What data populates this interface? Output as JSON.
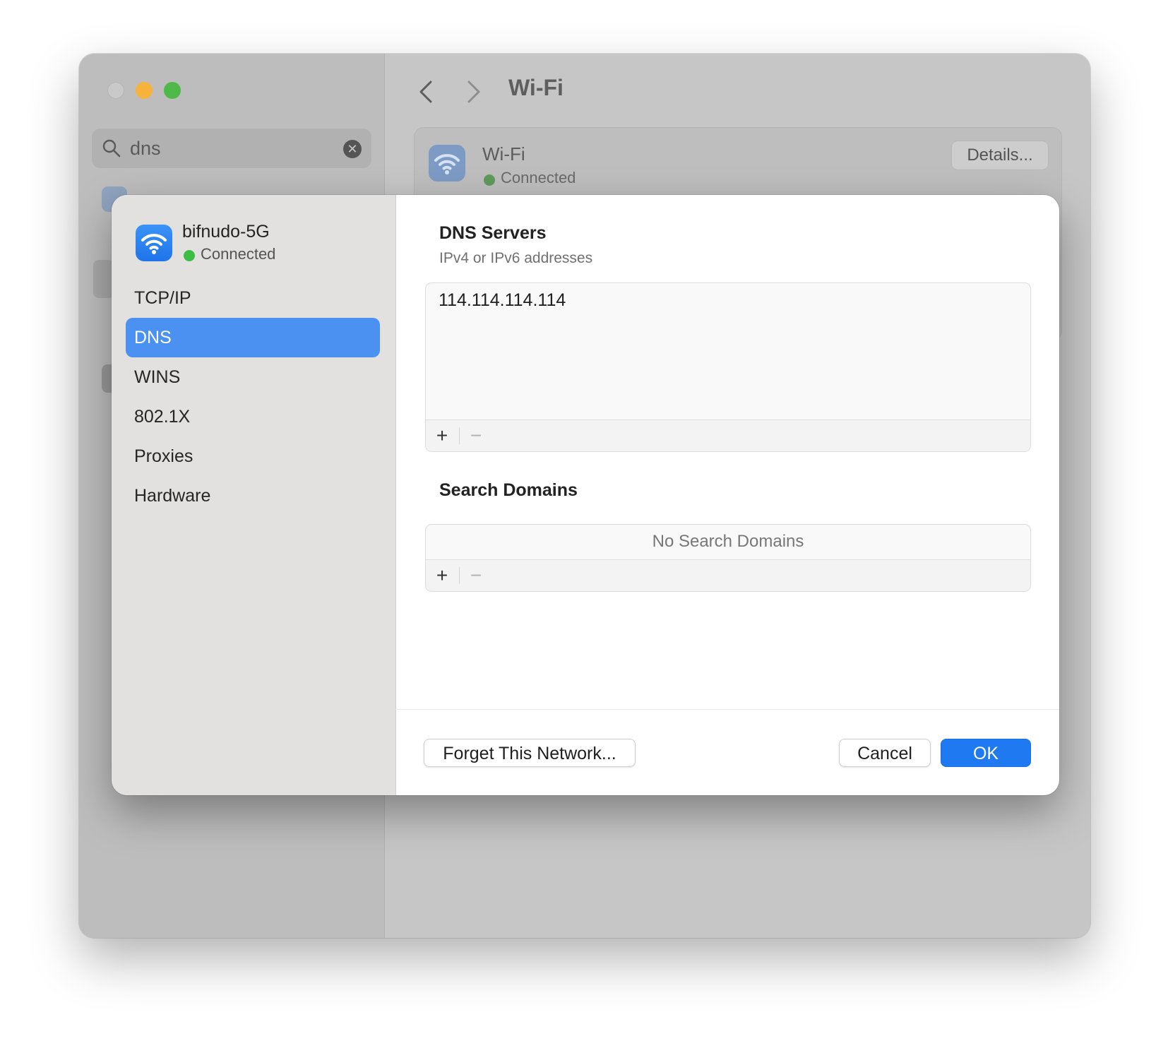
{
  "background_window": {
    "search": {
      "value": "dns",
      "clear_symbol": "✕"
    },
    "nav_title": "Wi-Fi",
    "wifi_card": {
      "name": "Wi-Fi",
      "status": "Connected",
      "details_label": "Details..."
    }
  },
  "sheet": {
    "network": {
      "name": "bifnudo-5G",
      "status": "Connected",
      "icon": "wifi-icon"
    },
    "sidebar": {
      "items": [
        {
          "label": "TCP/IP"
        },
        {
          "label": "DNS",
          "selected": true
        },
        {
          "label": "WINS"
        },
        {
          "label": "802.1X"
        },
        {
          "label": "Proxies"
        },
        {
          "label": "Hardware"
        }
      ]
    },
    "dns_servers": {
      "title": "DNS Servers",
      "subtitle": "IPv4 or IPv6 addresses",
      "entries": [
        "114.114.114.114"
      ],
      "add_symbol": "+",
      "remove_symbol": "−"
    },
    "search_domains": {
      "title": "Search Domains",
      "empty_text": "No Search Domains",
      "add_symbol": "+",
      "remove_symbol": "−"
    },
    "buttons": {
      "forget": "Forget This Network...",
      "cancel": "Cancel",
      "ok": "OK"
    }
  },
  "colors": {
    "accent": "#1f7af2",
    "sidebar_selected": "#4a91f2",
    "connected": "#3cbe46"
  }
}
